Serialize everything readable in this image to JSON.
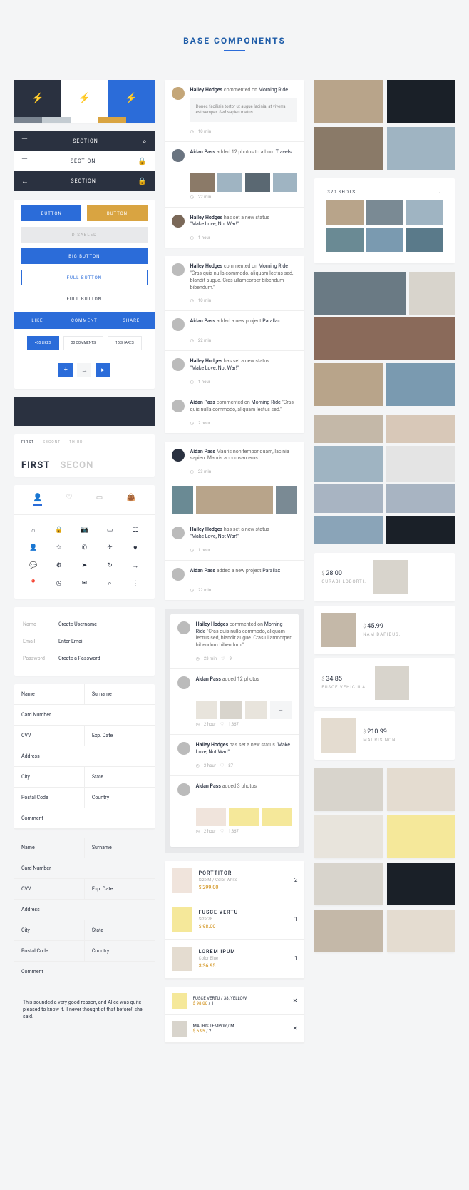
{
  "page_title": "BASE COMPONENTS",
  "swatches": [
    "#2a3140",
    "#ffffff",
    "#2b6cd9"
  ],
  "palette": [
    "#7a8490",
    "#c4ccd2",
    "#ffffff",
    "#d9a441",
    "#2b6cd9"
  ],
  "nav": {
    "label": "SECTION"
  },
  "buttons": {
    "primary": "BUTTON",
    "secondary": "BUTTON",
    "disabled": "DISABLED",
    "big": "BIG BUTTON",
    "full": "FULL BUTTON",
    "ghost": "FULL BUTTON"
  },
  "actions": {
    "like": "LIKE",
    "comment": "COMMENT",
    "share": "SHARE"
  },
  "stats": {
    "likes": "455 LIKES",
    "comments": "30 COMMENTS",
    "shares": "15 SHARES"
  },
  "subtabs": [
    "FIRST",
    "SECONT",
    "THIRD"
  ],
  "bigtabs": [
    "FIRST",
    "SECON"
  ],
  "form1": {
    "name_label": "Name",
    "name_ph": "Create Username",
    "email_label": "Email",
    "email_ph": "Enter Email",
    "pass_label": "Password",
    "pass_ph": "Create a Password"
  },
  "form2": {
    "name": "Name",
    "surname": "Surname",
    "card": "Card Number",
    "cvv": "CVV",
    "exp": "Exp. Date",
    "address": "Address",
    "city": "City",
    "state": "State",
    "postal": "Postal Code",
    "country": "Country",
    "comment": "Comment"
  },
  "note": "This sounded a very good reason, and Alice was quite pleased to know it. 'I never thought of that before!' she said.",
  "feed": [
    {
      "avatar": "#c4a678",
      "name": "Hailey Hodges",
      "action": "commented on",
      "object": "Morning Ride",
      "quote": "Donec facilisis tortor ut augue lacinia, at viverra est semper. Sed sapien metus.",
      "time": "10 min"
    },
    {
      "avatar": "#6a7480",
      "name": "Aidan Pass",
      "action": "added 12 photos to album",
      "object": "Travels",
      "thumbs": true,
      "time": "22 min"
    },
    {
      "avatar": "#7a6858",
      "name": "Hailey Hodges",
      "action": "has set a new status",
      "object": "\"Make Love, Not War!\"",
      "time": "1 hour"
    }
  ],
  "feed2": [
    {
      "name": "Hailey Hodges",
      "action": "commented on",
      "object": "Morning Ride",
      "quote": "\"Cras quis nulla commodo, aliquam lectus sed, blandit augue. Cras ullamcorper bibendum bibendum.\"",
      "time": "10 min"
    },
    {
      "name": "Aidan Pass",
      "action": "added a new project",
      "object": "Parallax",
      "time": "22 min"
    },
    {
      "name": "Hailey Hodges",
      "action": "has set a new status",
      "object": "\"Make Love, Not War!\"",
      "time": "1 hour"
    },
    {
      "name": "Aidan Pass",
      "action": "commented on",
      "object": "Morning Ride",
      "quote": "\"Cras quis nulla commodo, aliquam lectus sed.\"",
      "time": "2 hour"
    }
  ],
  "feed3": [
    {
      "name": "Aidan Pass",
      "text": "Mauris non tempor quam, lacinia sapien. Mauris accumsan eros.",
      "time": "23 min",
      "bigthumbs": true
    },
    {
      "name": "Hailey Hodges",
      "action": "has set a new status",
      "object": "\"Make Love, Not War!\"",
      "time": "1 hour"
    },
    {
      "name": "Aidan Pass",
      "action": "added a new project",
      "object": "Parallax",
      "time": "22 min"
    }
  ],
  "feed4": {
    "item1": {
      "name": "Hailey Hodges",
      "action": "commented on",
      "object": "Morning Ride",
      "quote": "\"Cras quis nulla commodo, aliquam lectus sed, blandit augue. Cras ullamcorper bibendum bibendum.\"",
      "time": "23 min",
      "likes": "9"
    },
    "item2": {
      "name": "Aidan Pass",
      "action": "added 12 photos",
      "time": "2 hour",
      "likes": "1,367"
    },
    "item3": {
      "name": "Hailey Hodges",
      "action": "has set a new status",
      "object": "\"Make Love, Not War!\"",
      "time": "3 hour",
      "likes": "87"
    },
    "item4": {
      "name": "Aidan Pass",
      "action": "added 3 photos",
      "time": "2 hour",
      "likes": "1,367"
    }
  },
  "shop": [
    {
      "name": "PORTTITOR",
      "sub": "Size M / Color White",
      "price": "$ 299.00",
      "qty": "2",
      "bg": "#f0e4dc"
    },
    {
      "name": "FUSCE VERTU",
      "sub": "Size 28",
      "price": "$ 98.00",
      "qty": "1",
      "bg": "#f5e89a"
    },
    {
      "name": "LOREM IPUM",
      "sub": "Color Blue",
      "price": "$ 36.95",
      "qty": "1",
      "bg": "#e4dcd0"
    }
  ],
  "cart": [
    {
      "name": "FUSCE VERTU / 38, YELLOW",
      "price": "$ 98.00",
      "qty": "/ 1"
    },
    {
      "name": "MAURIS TEMPOR / M",
      "price": "$ 6.95",
      "qty": "/ 2"
    }
  ],
  "shots_label": "320 SHOTS",
  "products": [
    {
      "price": "28.00",
      "name": "CURABI LOBORTI.",
      "right": true
    },
    {
      "price": "45.99",
      "name": "NAM DAPIBUS."
    },
    {
      "price": "34.85",
      "name": "FUSCE VEHICULA.",
      "right": true
    },
    {
      "price": "210.99",
      "name": "MAURIS NON."
    }
  ],
  "currency": "$"
}
